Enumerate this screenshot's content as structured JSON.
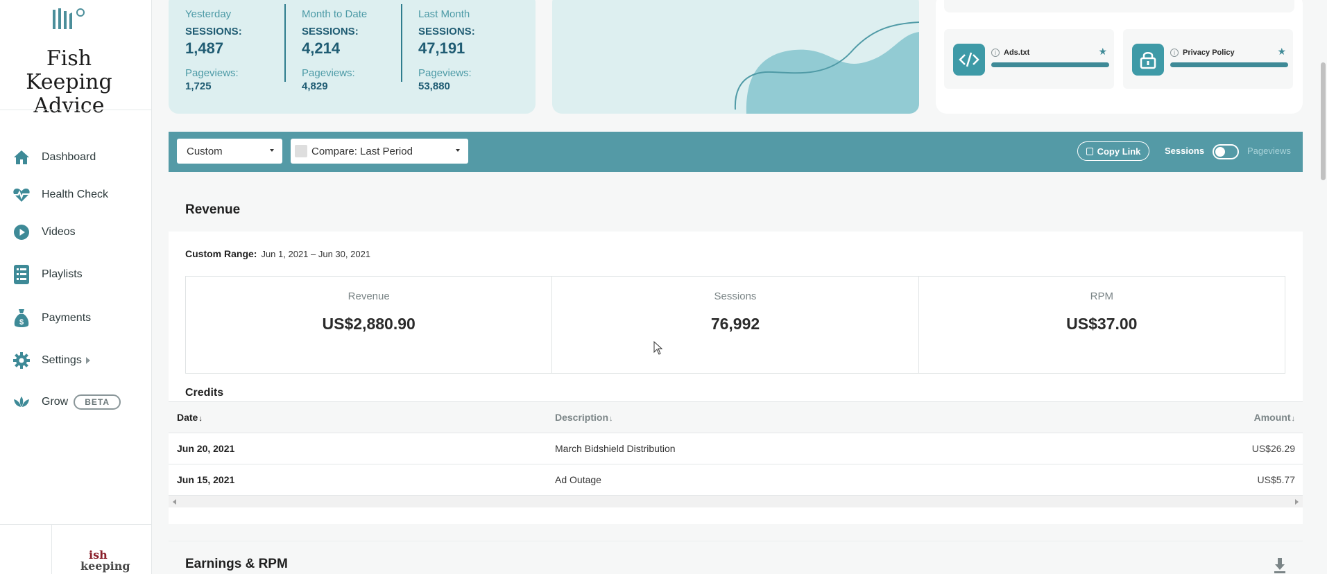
{
  "site": {
    "title": "Fish Keeping Advice"
  },
  "nav": {
    "items": [
      {
        "label": "Dashboard",
        "icon": "home-icon"
      },
      {
        "label": "Health Check",
        "icon": "heart-pulse-icon"
      },
      {
        "label": "Videos",
        "icon": "play-circle-icon"
      },
      {
        "label": "Playlists",
        "icon": "list-icon"
      },
      {
        "label": "Payments",
        "icon": "money-bag-icon"
      },
      {
        "label": "Settings",
        "icon": "gear-icon"
      },
      {
        "label": "Grow",
        "icon": "lotus-icon",
        "badge": "BETA"
      }
    ]
  },
  "partner_logo": {
    "line1": "ish",
    "line2": "keeping"
  },
  "stats": [
    {
      "period": "Yesterday",
      "sessions_label": "SESSIONS:",
      "sessions": "1,487",
      "pageviews_label": "Pageviews:",
      "pageviews": "1,725"
    },
    {
      "period": "Month to Date",
      "sessions_label": "SESSIONS:",
      "sessions": "4,214",
      "pageviews_label": "Pageviews:",
      "pageviews": "4,829"
    },
    {
      "period": "Last Month",
      "sessions_label": "SESSIONS:",
      "sessions": "47,191",
      "pageviews_label": "Pageviews:",
      "pageviews": "53,880"
    }
  ],
  "tools": [
    {
      "name": "Ads.txt",
      "icon": "code-icon"
    },
    {
      "name": "Privacy Policy",
      "icon": "lock-icon"
    }
  ],
  "filters": {
    "range_select": "Custom",
    "compare_select": "Compare: Last Period",
    "copy_link": "Copy Link",
    "toggle_on_label": "Sessions",
    "toggle_off_label": "Pageviews"
  },
  "revenue": {
    "title": "Revenue",
    "range_label": "Custom Range:",
    "range_value": "Jun 1, 2021 – Jun 30, 2021",
    "kpis": [
      {
        "label": "Revenue",
        "value": "US$2,880.90"
      },
      {
        "label": "Sessions",
        "value": "76,992"
      },
      {
        "label": "RPM",
        "value": "US$37.00"
      }
    ],
    "credits_title": "Credits",
    "columns": [
      "Date",
      "Description",
      "Amount"
    ],
    "rows": [
      {
        "date": "Jun 20, 2021",
        "description": "March Bidshield Distribution",
        "amount": "US$26.29"
      },
      {
        "date": "Jun 15, 2021",
        "description": "Ad Outage",
        "amount": "US$5.77"
      }
    ]
  },
  "earnings": {
    "title": "Earnings & RPM"
  },
  "colors": {
    "accent": "#549aa6",
    "card_bg": "#ddeff0",
    "dark_teal": "#1f5c73"
  }
}
